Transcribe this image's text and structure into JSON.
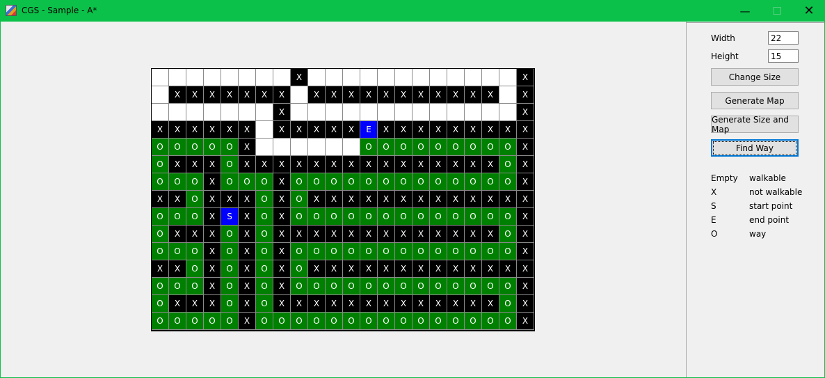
{
  "window": {
    "title": "CGS - Sample - A*",
    "minimize_icon": "minimize-icon",
    "maximize_icon": "maximize-icon",
    "close_icon": "close-icon",
    "minimize_glyph": "—",
    "maximize_glyph": "☐",
    "close_glyph": "✕"
  },
  "controls": {
    "width_label": "Width",
    "width_value": "22",
    "height_label": "Height",
    "height_value": "15",
    "change_size": "Change Size",
    "generate_map": "Generate Map",
    "generate_size_and_map": "Generate Size and Map",
    "find_way": "Find Way"
  },
  "legend": [
    {
      "symbol": "Empty",
      "meaning": "walkable"
    },
    {
      "symbol": "X",
      "meaning": "not walkable"
    },
    {
      "symbol": "S",
      "meaning": "start point"
    },
    {
      "symbol": "E",
      "meaning": "end point"
    },
    {
      "symbol": "O",
      "meaning": "way"
    }
  ],
  "grid": {
    "columns": 22,
    "rows": [
      "        X            X",
      " XXXXXXX XXXXXXXXXXX X",
      "       X             X",
      "XXXXXX XXXXXEXXXXXXXXX",
      "OOOOOX      OOOOOOOOOX",
      "OXXXOXXXXXXXXXXXXXXXOX",
      "OOOXOOOXOOOOOOOOOOOOOX",
      "XXOXXXOXOXXXXXXXXXXXXX",
      "OOOXSXOXOOOOOOOOOOOOOX",
      "OXXXOXOXXXXXXXXXXXXXOX",
      "OOOXOXOXOOOOOOOOOOOOOX",
      "XXOXOXOXOXXXXXXXXXXXXX",
      "OOOXOXOXOOOOOOOOOOOOOX",
      "OXXXOXOXXXXXXXXXXXXXOX",
      "OOOOOXOOOOOOOOOOOOOOOX"
    ]
  }
}
